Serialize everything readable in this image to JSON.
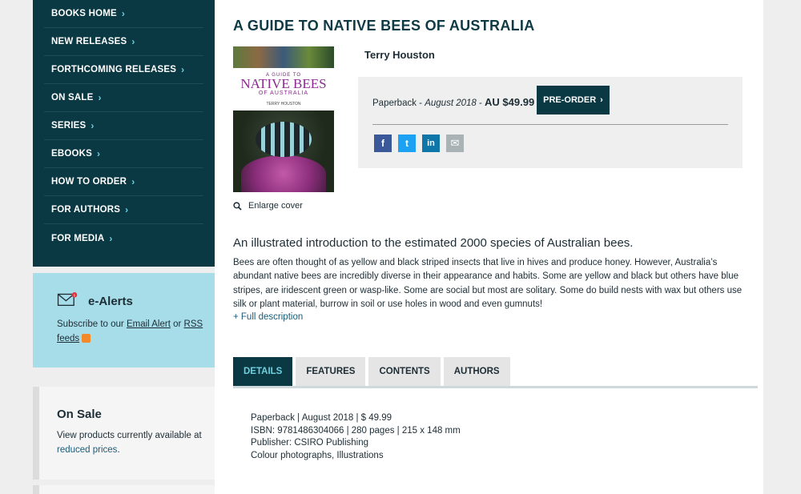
{
  "nav": {
    "items": [
      {
        "label": "BOOKS HOME"
      },
      {
        "label": "NEW RELEASES"
      },
      {
        "label": "FORTHCOMING RELEASES"
      },
      {
        "label": "ON SALE"
      },
      {
        "label": "SERIES"
      },
      {
        "label": "EBOOKS"
      },
      {
        "label": "HOW TO ORDER"
      },
      {
        "label": "FOR AUTHORS"
      },
      {
        "label": "FOR MEDIA"
      }
    ],
    "chevron": "›"
  },
  "alerts": {
    "title": "e-Alerts",
    "text_prefix": "Subscribe to our ",
    "email_link": "Email Alert",
    "or": " or ",
    "rss_link_1": "RSS",
    "rss_link_2": "feeds",
    "icon": "mail-icon",
    "badge": "!"
  },
  "onsale": {
    "title": "On Sale",
    "text_prefix": "View products currently available at ",
    "link": "reduced prices",
    "suffix": "."
  },
  "book": {
    "title": "A GUIDE TO NATIVE BEES OF AUSTRALIA",
    "author": "Terry Houston",
    "cover": {
      "small": "A GUIDE TO",
      "big": "NATIVE BEES",
      "sub": "OF AUSTRALIA",
      "author": "TERRY HOUSTON"
    },
    "enlarge_label": "Enlarge cover",
    "format": "Paperback",
    "sep": " - ",
    "date": "August 2018",
    "sep2": " - ",
    "price": "AU $49.99",
    "preorder_label": "PRE-ORDER",
    "share": [
      {
        "name": "facebook-icon",
        "glyph": "f",
        "color": "#3b5998"
      },
      {
        "name": "twitter-icon",
        "glyph": "t",
        "color": "#1da1f2"
      },
      {
        "name": "linkedin-icon",
        "glyph": "in",
        "color": "#0e76a8"
      },
      {
        "name": "email-icon",
        "glyph": "✉",
        "color": "#a9b3b5"
      }
    ],
    "blurb": "An illustrated introduction to the estimated 2000 species of Australian bees.",
    "description": "Bees are often thought of as yellow and black striped insects that live in hives and produce honey. However, Australia’s abundant native bees are incredibly diverse in their appearance and habits. Some are yellow and black but others have blue stripes, are iridescent green or wasp-like. Some are social but most are solitary. Some do build nests with wax but others use silk or plant material, burrow in soil or use holes in wood and even gumnuts!",
    "full_description": "+ Full description"
  },
  "tabs": [
    {
      "label": "DETAILS",
      "active": true
    },
    {
      "label": "FEATURES",
      "active": false
    },
    {
      "label": "CONTENTS",
      "active": false
    },
    {
      "label": "AUTHORS",
      "active": false
    }
  ],
  "details": {
    "line1": "Paperback | August 2018 | $ 49.99",
    "line2": "ISBN: 9781486304066 | 280 pages | 215 x 148 mm",
    "line3": "Publisher: CSIRO Publishing",
    "line4": "Colour photographs, Illustrations"
  },
  "colors": {
    "brand_dark": "#0a3843",
    "accent_cyan": "#6fd1df",
    "alerts_bg": "#a7dde9",
    "link": "#1b5b78"
  }
}
